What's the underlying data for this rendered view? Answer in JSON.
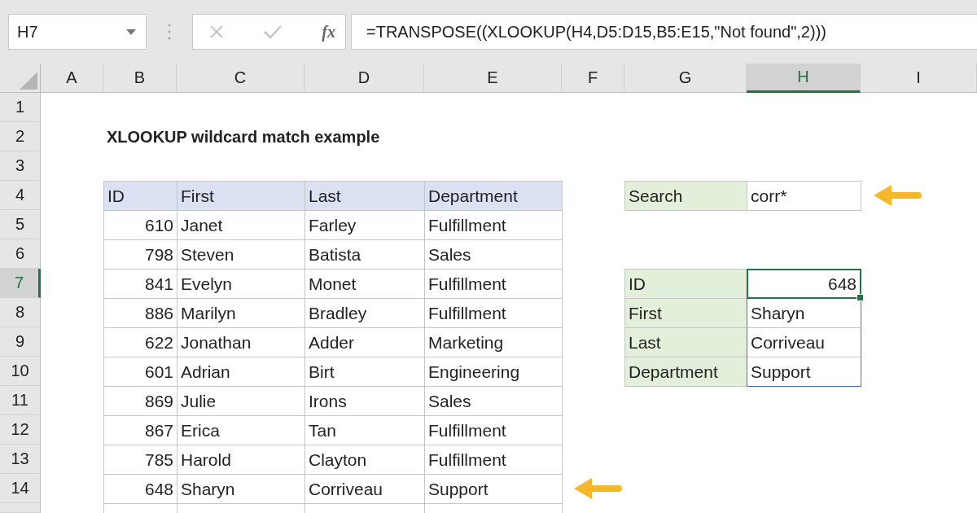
{
  "formula_bar": {
    "name_box": "H7",
    "insert_function": "fx",
    "formula": "=TRANSPOSE((XLOOKUP(H4,D5:D15,B5:E15,\"Not found\",2)))"
  },
  "columns": [
    {
      "label": "A",
      "selected": false
    },
    {
      "label": "B",
      "selected": false
    },
    {
      "label": "C",
      "selected": false
    },
    {
      "label": "D",
      "selected": false
    },
    {
      "label": "E",
      "selected": false
    },
    {
      "label": "F",
      "selected": false
    },
    {
      "label": "G",
      "selected": false
    },
    {
      "label": "H",
      "selected": true
    },
    {
      "label": "I",
      "selected": false
    }
  ],
  "rows": [
    {
      "label": "1",
      "selected": false
    },
    {
      "label": "2",
      "selected": false
    },
    {
      "label": "3",
      "selected": false
    },
    {
      "label": "4",
      "selected": false
    },
    {
      "label": "5",
      "selected": false
    },
    {
      "label": "6",
      "selected": false
    },
    {
      "label": "7",
      "selected": true
    },
    {
      "label": "8",
      "selected": false
    },
    {
      "label": "9",
      "selected": false
    },
    {
      "label": "10",
      "selected": false
    },
    {
      "label": "11",
      "selected": false
    },
    {
      "label": "12",
      "selected": false
    },
    {
      "label": "13",
      "selected": false
    },
    {
      "label": "14",
      "selected": false
    }
  ],
  "title": "XLOOKUP wildcard match example",
  "table": {
    "columns": [
      "ID",
      "First",
      "Last",
      "Department"
    ],
    "rows": [
      [
        "610",
        "Janet",
        "Farley",
        "Fulfillment"
      ],
      [
        "798",
        "Steven",
        "Batista",
        "Sales"
      ],
      [
        "841",
        "Evelyn",
        "Monet",
        "Fulfillment"
      ],
      [
        "886",
        "Marilyn",
        "Bradley",
        "Fulfillment"
      ],
      [
        "622",
        "Jonathan",
        "Adder",
        "Marketing"
      ],
      [
        "601",
        "Adrian",
        "Birt",
        "Engineering"
      ],
      [
        "869",
        "Julie",
        "Irons",
        "Sales"
      ],
      [
        "867",
        "Erica",
        "Tan",
        "Fulfillment"
      ],
      [
        "785",
        "Harold",
        "Clayton",
        "Fulfillment"
      ],
      [
        "648",
        "Sharyn",
        "Corriveau",
        "Support"
      ]
    ]
  },
  "search": {
    "label": "Search",
    "value": "corr*"
  },
  "result": [
    {
      "label": "ID",
      "value": "648",
      "numeric": true,
      "selected": true
    },
    {
      "label": "First",
      "value": "Sharyn",
      "numeric": false,
      "selected": false
    },
    {
      "label": "Last",
      "value": "Corriveau",
      "numeric": false,
      "selected": false
    },
    {
      "label": "Department",
      "value": "Support",
      "numeric": false,
      "selected": false
    }
  ]
}
